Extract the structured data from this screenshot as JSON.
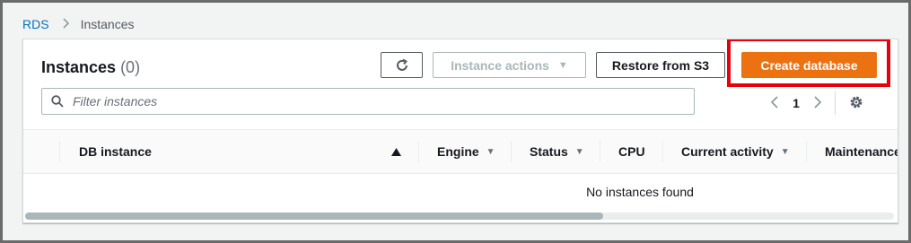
{
  "breadcrumb": {
    "root": "RDS",
    "separator": ">",
    "current": "Instances"
  },
  "panel": {
    "title": "Instances",
    "count": "(0)",
    "buttons": {
      "refresh_icon": "refresh-icon",
      "instance_actions": "Instance actions",
      "restore": "Restore from S3",
      "create": "Create database"
    },
    "search_placeholder": "Filter instances",
    "pagination": {
      "prev": "<",
      "page": "1",
      "next": ">"
    },
    "columns": [
      {
        "label": "DB instance"
      },
      {
        "label": "Engine"
      },
      {
        "label": "Status"
      },
      {
        "label": "CPU"
      },
      {
        "label": "Current activity"
      },
      {
        "label": "Maintenance"
      }
    ],
    "empty_message": "No instances found"
  },
  "colors": {
    "primary": "#ec7211",
    "link": "#0073bb",
    "highlight": "#e8000b"
  }
}
